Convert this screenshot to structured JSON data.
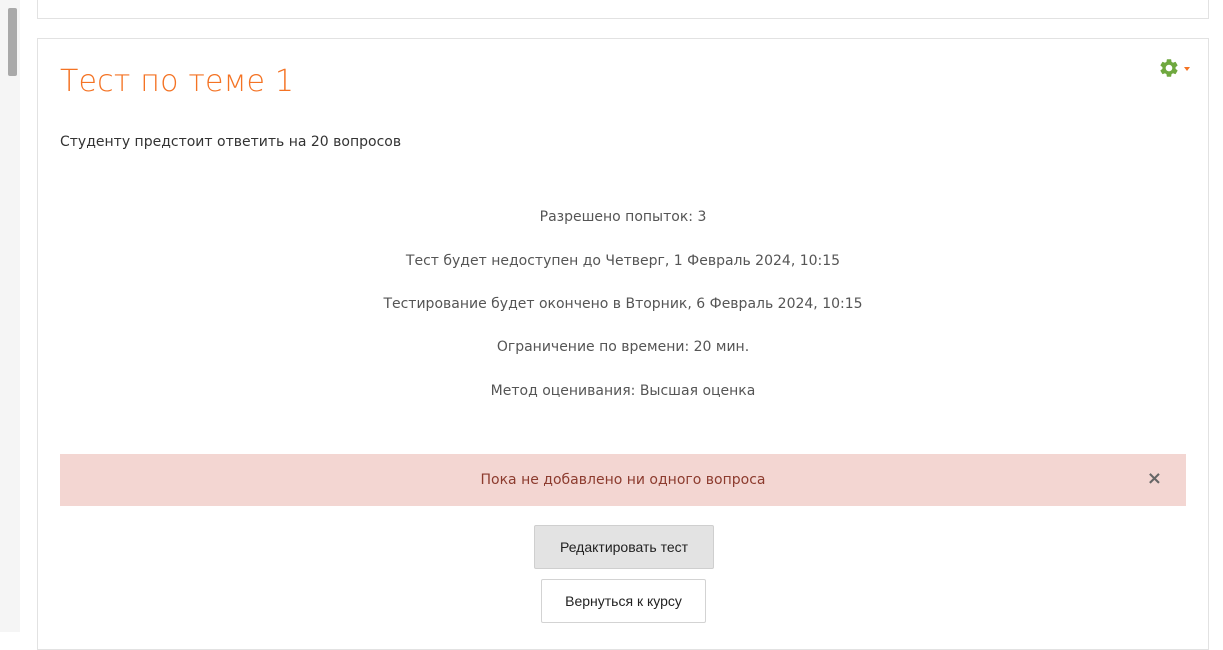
{
  "quiz": {
    "title": "Тест по теме 1",
    "intro": "Студенту предстоит ответить на 20 вопросов",
    "info": [
      "Разрешено попыток: 3",
      "Тест будет недоступен до Четверг, 1 Февраль 2024, 10:15",
      "Тестирование будет окончено в Вторник, 6 Февраль 2024, 10:15",
      "Ограничение по времени: 20 мин.",
      "Метод оценивания: Высшая оценка"
    ],
    "alert": {
      "message": "Пока не добавлено ни одного вопроса",
      "close_symbol": "×"
    },
    "buttons": {
      "edit": "Редактировать тест",
      "back": "Вернуться к курсу"
    }
  },
  "icons": {
    "settings": "gear-icon",
    "menu": "caret-down-icon"
  },
  "colors": {
    "accent": "#f47324",
    "gear": "#6fa83f",
    "alert_bg": "#f3d6d2",
    "alert_text": "#8c3b2e"
  }
}
